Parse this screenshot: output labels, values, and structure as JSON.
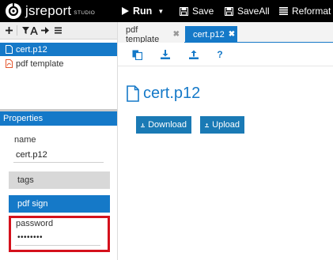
{
  "topbar": {
    "logo_text": "jsreport",
    "logo_sub": "STUDIO",
    "run_label": "Run",
    "save_label": "Save",
    "saveall_label": "SaveAll",
    "reformat_label": "Reformat"
  },
  "tree": {
    "toolbar_icons": [
      "plus-icon",
      "filter-icon",
      "text-sort-icon",
      "arrow-right-icon",
      "hamburger-icon"
    ],
    "items": [
      {
        "label": "cert.p12",
        "icon": "file-icon",
        "selected": true
      },
      {
        "label": "pdf template",
        "icon": "pdf-file-icon",
        "selected": false
      }
    ]
  },
  "properties": {
    "header": "Properties",
    "name_label": "name",
    "name_value": "cert.p12",
    "tags_label": "tags",
    "pdfsign_label": "pdf sign",
    "password_label": "password",
    "password_value": "••••••••"
  },
  "tabs": [
    {
      "label": "pdf template",
      "active": false
    },
    {
      "label": "cert.p12",
      "active": true
    }
  ],
  "editor_toolbar": {
    "icons": [
      "copy-icon",
      "download-icon",
      "upload-icon",
      "help-icon"
    ],
    "help_glyph": "?"
  },
  "content": {
    "title": "cert.p12",
    "download_label": "Download",
    "upload_label": "Upload"
  },
  "colors": {
    "accent": "#1579c8",
    "topbar": "#000000",
    "highlight": "#d4111c",
    "pdf_icon": "#e4572e"
  }
}
